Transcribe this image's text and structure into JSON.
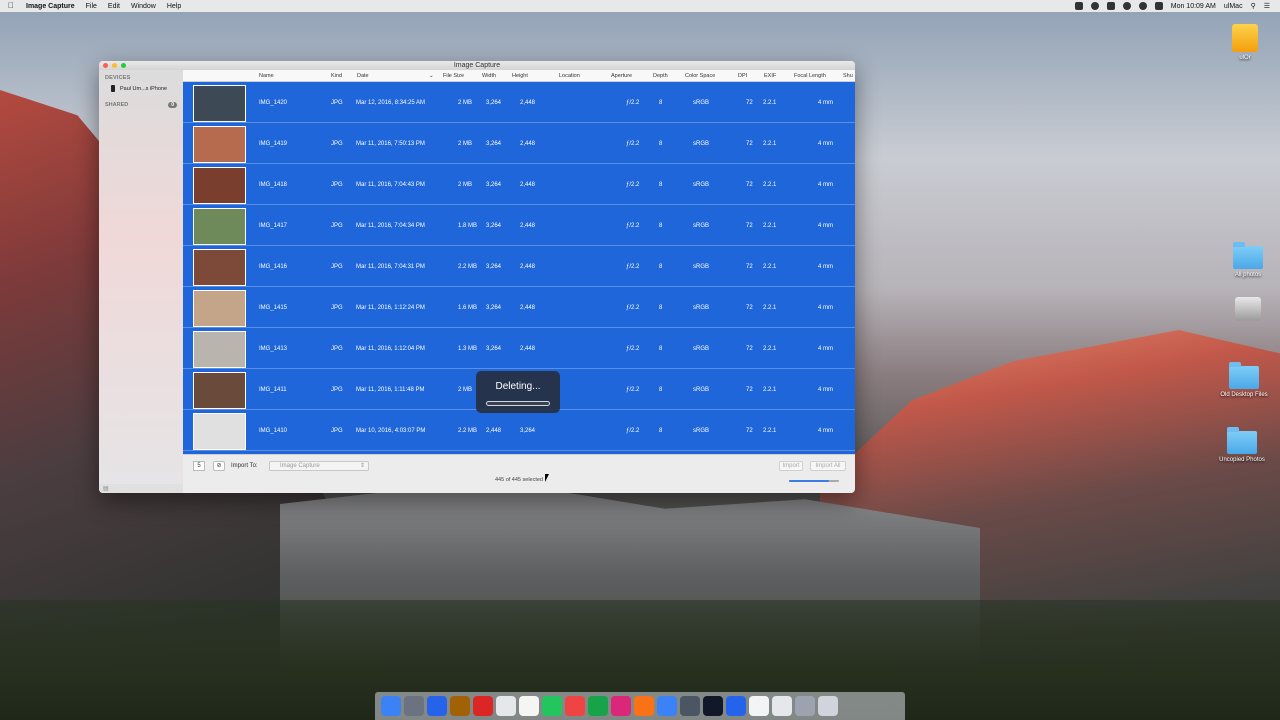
{
  "menubar": {
    "app_name": "Image Capture",
    "menus": [
      "File",
      "Edit",
      "Window",
      "Help"
    ],
    "clock": "Mon 10:09 AM",
    "user": "ulMac"
  },
  "window": {
    "title": "Image Capture",
    "sidebar": {
      "devices_header": "DEVICES",
      "device_name": "Paul Um...s iPhone",
      "shared_header": "SHARED",
      "shared_count": "0"
    },
    "columns": {
      "name": "Name",
      "kind": "Kind",
      "date": "Date",
      "file_size": "File Size",
      "width": "Width",
      "height": "Height",
      "location": "Location",
      "aperture": "Aperture",
      "depth": "Depth",
      "color_space": "Color Space",
      "dpi": "DPI",
      "exif": "EXIF",
      "focal_length": "Focal Length",
      "shutter": "Shu"
    },
    "rows": [
      {
        "name": "IMG_1420",
        "kind": "JPG",
        "date": "Mar 12, 2016, 8:34:25 AM",
        "size": "2 MB",
        "width": "3,264",
        "height": "2,448",
        "aperture": "ƒ/2.2",
        "depth": "8",
        "color_space": "sRGB",
        "dpi": "72",
        "exif": "2.2.1",
        "focal": "4 mm"
      },
      {
        "name": "IMG_1419",
        "kind": "JPG",
        "date": "Mar 11, 2016, 7:50:13 PM",
        "size": "2 MB",
        "width": "3,264",
        "height": "2,448",
        "aperture": "ƒ/2.2",
        "depth": "8",
        "color_space": "sRGB",
        "dpi": "72",
        "exif": "2.2.1",
        "focal": "4 mm"
      },
      {
        "name": "IMG_1418",
        "kind": "JPG",
        "date": "Mar 11, 2016, 7:04:43 PM",
        "size": "2 MB",
        "width": "3,264",
        "height": "2,448",
        "aperture": "ƒ/2.2",
        "depth": "8",
        "color_space": "sRGB",
        "dpi": "72",
        "exif": "2.2.1",
        "focal": "4 mm"
      },
      {
        "name": "IMG_1417",
        "kind": "JPG",
        "date": "Mar 11, 2016, 7:04:34 PM",
        "size": "1.8 MB",
        "width": "3,264",
        "height": "2,448",
        "aperture": "ƒ/2.2",
        "depth": "8",
        "color_space": "sRGB",
        "dpi": "72",
        "exif": "2.2.1",
        "focal": "4 mm"
      },
      {
        "name": "IMG_1416",
        "kind": "JPG",
        "date": "Mar 11, 2016, 7:04:31 PM",
        "size": "2.2 MB",
        "width": "3,264",
        "height": "2,448",
        "aperture": "ƒ/2.2",
        "depth": "8",
        "color_space": "sRGB",
        "dpi": "72",
        "exif": "2.2.1",
        "focal": "4 mm"
      },
      {
        "name": "IMG_1415",
        "kind": "JPG",
        "date": "Mar 11, 2016, 1:12:24 PM",
        "size": "1.6 MB",
        "width": "3,264",
        "height": "2,448",
        "aperture": "ƒ/2.2",
        "depth": "8",
        "color_space": "sRGB",
        "dpi": "72",
        "exif": "2.2.1",
        "focal": "4 mm"
      },
      {
        "name": "IMG_1413",
        "kind": "JPG",
        "date": "Mar 11, 2016, 1:12:04 PM",
        "size": "1.3 MB",
        "width": "3,264",
        "height": "2,448",
        "aperture": "ƒ/2.2",
        "depth": "8",
        "color_space": "sRGB",
        "dpi": "72",
        "exif": "2.2.1",
        "focal": "4 mm"
      },
      {
        "name": "IMG_1411",
        "kind": "JPG",
        "date": "Mar 11, 2016, 1:11:48 PM",
        "size": "2 MB",
        "width": "",
        "height": "",
        "aperture": "ƒ/2.2",
        "depth": "8",
        "color_space": "sRGB",
        "dpi": "72",
        "exif": "2.2.1",
        "focal": "4 mm"
      },
      {
        "name": "IMG_1410",
        "kind": "JPG",
        "date": "Mar 10, 2016, 4:03:07 PM",
        "size": "2.2 MB",
        "width": "2,448",
        "height": "3,264",
        "aperture": "ƒ/2.2",
        "depth": "8",
        "color_space": "sRGB",
        "dpi": "72",
        "exif": "2.2.1",
        "focal": "4 mm"
      }
    ],
    "thumb_colors": [
      "#3d4a55",
      "#b66a4e",
      "#7a3e2e",
      "#6f8a5a",
      "#7d4a3a",
      "#c4a58a",
      "#b9b4ad",
      "#6a4a3a",
      "#e0e0e0"
    ],
    "bottombar": {
      "count": "5",
      "import_label": "Import To:",
      "import_target": "Image Capture",
      "import_button": "Import",
      "import_all_button": "Import All",
      "status": "445 of 445 selected",
      "zoom_level": 0.8
    },
    "hud": {
      "text": "Deleting..."
    }
  },
  "desktop": {
    "icons": [
      "ulOr",
      "All photos",
      "Old Desktop Files",
      "Uncopied Photos"
    ]
  },
  "dock_colors": [
    "#3b82f6",
    "#6b7280",
    "#2563eb",
    "#a16207",
    "#dc2626",
    "#e5e7eb",
    "#f5f5f4",
    "#22c55e",
    "#ef4444",
    "#16a34a",
    "#db2777",
    "#f97316",
    "#3b82f6",
    "#4b5563",
    "#111827",
    "#2563eb",
    "#f3f4f6",
    "#e5e7eb",
    "#9ca3af",
    "#d1d5db"
  ]
}
